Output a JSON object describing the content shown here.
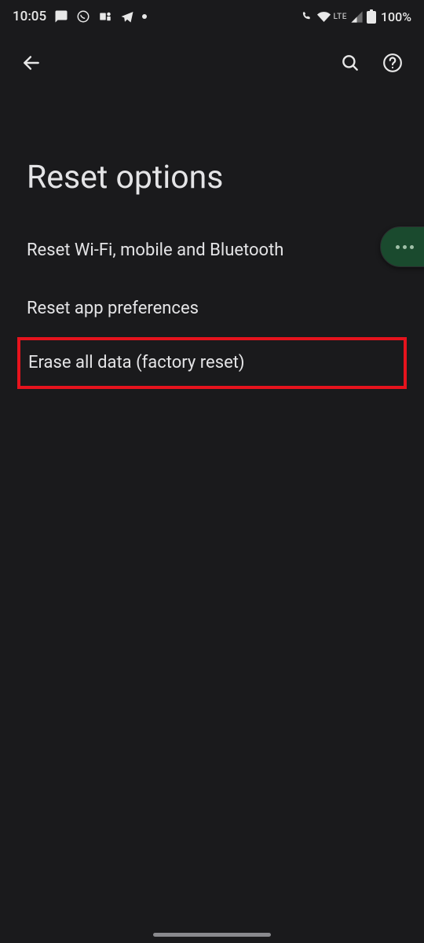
{
  "status": {
    "time": "10:05",
    "lte": "LTE",
    "battery": "100%"
  },
  "page": {
    "title": "Reset options"
  },
  "options": [
    {
      "label": "Reset Wi-Fi, mobile and Bluetooth"
    },
    {
      "label": "Reset app preferences"
    },
    {
      "label": "Erase all data (factory reset)"
    }
  ]
}
